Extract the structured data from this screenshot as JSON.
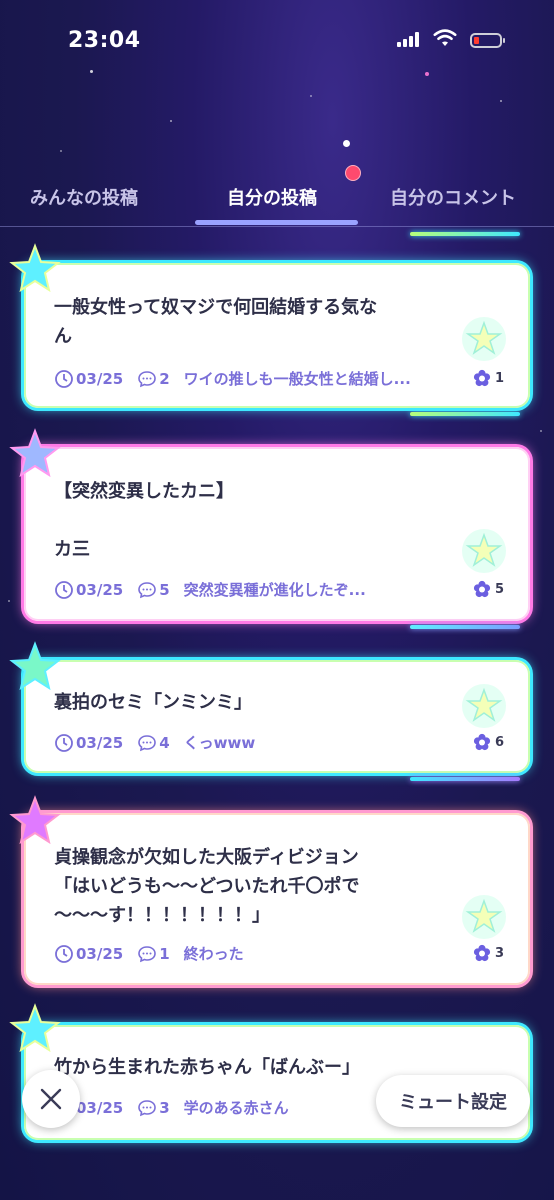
{
  "status_bar": {
    "time": "23:04"
  },
  "tabs": [
    {
      "label": "みんなの投稿",
      "active": false
    },
    {
      "label": "自分の投稿",
      "active": true
    },
    {
      "label": "自分のコメント",
      "active": false
    }
  ],
  "posts": [
    {
      "title": "一般女性って奴マジで何回結婚する気な\nん",
      "date": "03/25",
      "comments": "2",
      "latest_comment": "ワイの推しも一般女性と結婚し...",
      "likes": "1",
      "accent": "#3ee8ff"
    },
    {
      "title": "【突然変異したカニ】\n\nカ三",
      "date": "03/25",
      "comments": "5",
      "latest_comment": "突然変異種が進化したぞ...",
      "likes": "5",
      "accent": "#ff7ae6"
    },
    {
      "title": "裏拍のセミ「ンミンミ」",
      "date": "03/25",
      "comments": "4",
      "latest_comment": "くっwww",
      "likes": "6",
      "accent": "#3ee8ff"
    },
    {
      "title": "貞操観念が欠如した大阪ディビジョン\n「はいどうも〜〜どついたれ千〇ポで\n〜〜〜す！！！！！！！」",
      "date": "03/25",
      "comments": "1",
      "latest_comment": "終わった",
      "likes": "3",
      "accent": "#ff9a7a"
    },
    {
      "title": "竹から生まれた赤ちゃん「ばんぶー」",
      "date": "03/25",
      "comments": "3",
      "latest_comment": "学のある赤さん",
      "likes": "",
      "accent": "#3ee8ff"
    }
  ],
  "bottom": {
    "mute_label": "ミュート設定"
  },
  "icons": {
    "clock": "clock-icon",
    "comment": "comment-bubble-icon",
    "like": "flower-icon",
    "close": "close-icon"
  },
  "colors": {
    "meta_text": "#7a6fd8",
    "title_text": "#2e2f48",
    "tab_underline": "#9aa2ff",
    "notification": "#ff4a6e"
  }
}
